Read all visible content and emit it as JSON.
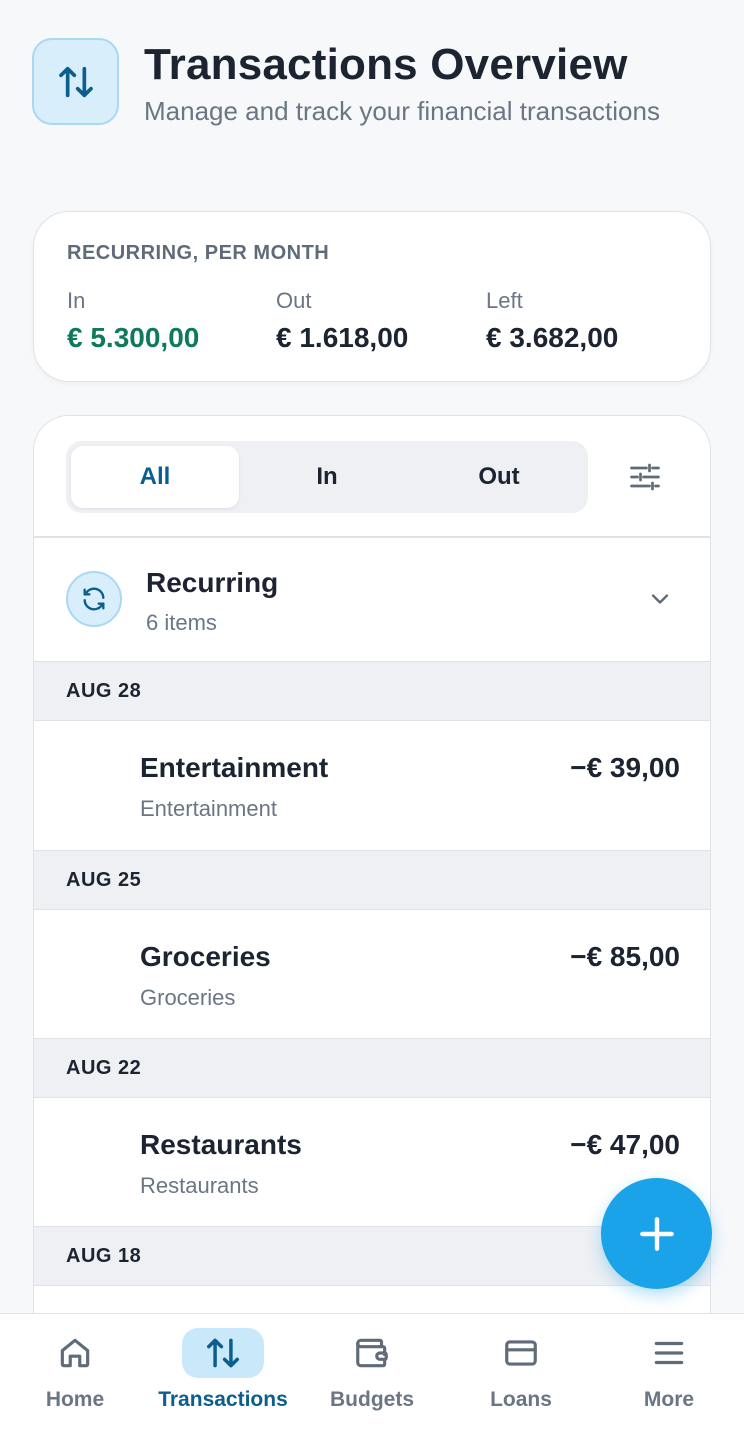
{
  "header": {
    "icon": "arrows-up-down-icon",
    "title": "Transactions Overview",
    "subtitle": "Manage and track your financial transactions"
  },
  "summary": {
    "label": "RECURRING, PER MONTH",
    "in_label": "In",
    "in_value": "€ 5.300,00",
    "out_label": "Out",
    "out_value": "€ 1.618,00",
    "left_label": "Left",
    "left_value": "€ 3.682,00"
  },
  "filter": {
    "tabs": [
      "All",
      "In",
      "Out"
    ],
    "selected": "All",
    "icon": "sliders-icon"
  },
  "recurring": {
    "title": "Recurring",
    "count": "6 items",
    "icon": "refresh-icon"
  },
  "groups": [
    {
      "date": "AUG 28",
      "title": "Entertainment",
      "category": "Entertainment",
      "amount": "−€ 39,00"
    },
    {
      "date": "AUG 25",
      "title": "Groceries",
      "category": "Groceries",
      "amount": "−€ 85,00"
    },
    {
      "date": "AUG 22",
      "title": "Restaurants",
      "category": "Restaurants",
      "amount": "−€ 47,00"
    },
    {
      "date": "AUG 18"
    }
  ],
  "nav": {
    "items": [
      "Home",
      "Transactions",
      "Budgets",
      "Loans",
      "More"
    ],
    "active": "Transactions"
  },
  "colors": {
    "accent": "#1aa3e8",
    "accent_dark": "#0b5e8e",
    "positive": "#0e7a5b"
  }
}
